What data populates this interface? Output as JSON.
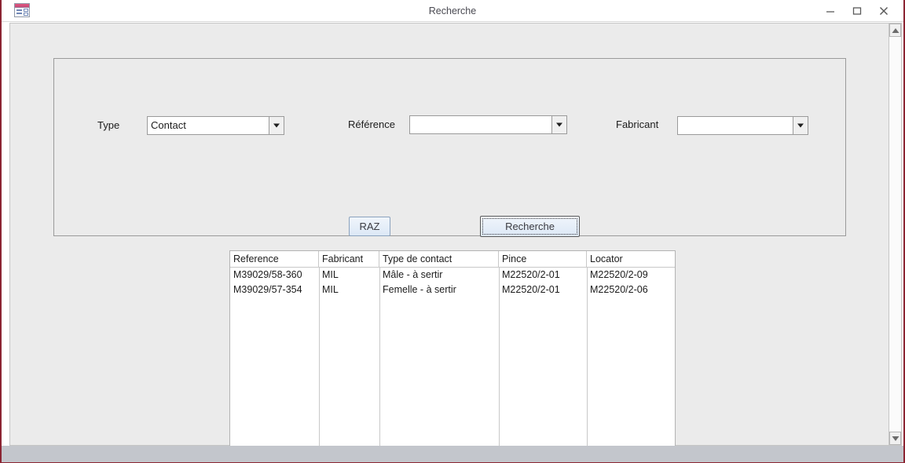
{
  "window": {
    "title": "Recherche",
    "icon": "access-form-icon",
    "controls": {
      "minimize": "minimize-icon",
      "maximize": "maximize-icon",
      "close": "close-icon"
    }
  },
  "criteria": {
    "fields": [
      {
        "label": "Type",
        "value": "Contact",
        "placeholder": ""
      },
      {
        "label": "Référence",
        "value": "",
        "placeholder": ""
      },
      {
        "label": "Fabricant",
        "value": "",
        "placeholder": ""
      }
    ]
  },
  "actions": {
    "reset_label": "RAZ",
    "search_label": "Recherche"
  },
  "results": {
    "columns": [
      "Reference",
      "Fabricant",
      "Type de contact",
      "Pince",
      "Locator"
    ],
    "rows": [
      {
        "reference": "M39029/58-360",
        "fabricant": "MIL",
        "type_de_contact": "Mâle - à sertir",
        "pince": "M22520/2-01",
        "locator": "M22520/2-09"
      },
      {
        "reference": "M39029/57-354",
        "fabricant": "MIL",
        "type_de_contact": "Femelle - à sertir",
        "pince": "M22520/2-01",
        "locator": "M22520/2-06"
      }
    ]
  },
  "scrollbar": {
    "up_arrow": "triangle-up-icon",
    "down_arrow": "triangle-down-icon"
  },
  "colors": {
    "window_border": "#8b2432",
    "client_background": "#ebebeb",
    "button_accent": "#dce8f6",
    "grid_background": "#ffffff"
  }
}
